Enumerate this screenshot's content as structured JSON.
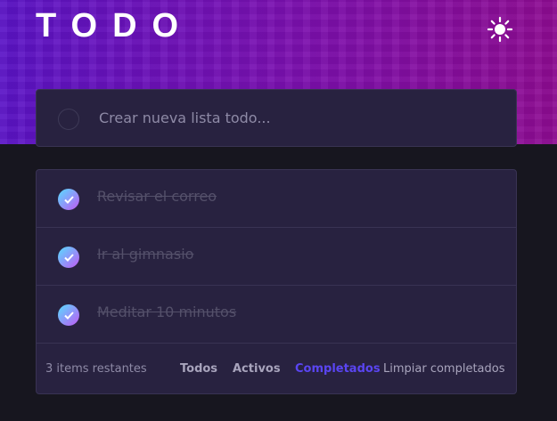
{
  "header": {
    "title": "TODO",
    "theme_icon": "sun-icon"
  },
  "new_todo": {
    "placeholder": "Crear nueva lista todo...",
    "value": ""
  },
  "todos": [
    {
      "text": "Revisar el correo",
      "completed": true
    },
    {
      "text": "Ir al gimnasio",
      "completed": true
    },
    {
      "text": "Meditar 10 minutos",
      "completed": true
    }
  ],
  "footer": {
    "items_left": "3 items restantes",
    "filter_all": "Todos",
    "filter_active": "Activos",
    "filter_completed": "Completados",
    "clear_completed": "Limpiar completados",
    "active_filter": "Completados"
  },
  "colors": {
    "accent": "#5a45f2",
    "check_gradient_start": "#57ddff",
    "check_gradient_end": "#c058f3"
  }
}
